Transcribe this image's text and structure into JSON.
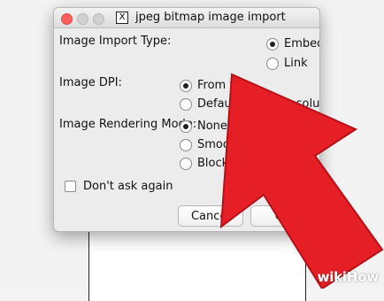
{
  "window": {
    "title": "jpeg bitmap image import",
    "x11_glyph": "X"
  },
  "dialog": {
    "image_import_type": {
      "label": "Image Import Type:",
      "options": [
        {
          "label": "Embed",
          "selected": true
        },
        {
          "label": "Link",
          "selected": false
        }
      ]
    },
    "image_dpi": {
      "label": "Image DPI:",
      "options": [
        {
          "label": "From file",
          "selected": true
        },
        {
          "label": "Default import resolution",
          "selected": false
        }
      ]
    },
    "image_rendering_mode": {
      "label": "Image Rendering Mode:",
      "options": [
        {
          "label": "None (auto)",
          "selected": true
        },
        {
          "label": "Smooth (optimizeQuality)",
          "selected": false
        },
        {
          "label": "Blocky (optimizeSpeed)",
          "selected": false
        }
      ]
    },
    "dont_ask_again": {
      "label": "Don't ask again",
      "checked": false
    },
    "buttons": {
      "cancel": "Cancel",
      "ok": "OK"
    }
  },
  "watermark": {
    "text": "wikiHow"
  },
  "colors": {
    "arrow": "#e61f26",
    "close_button": "#fc605c",
    "dialog_bg": "#ececec"
  }
}
